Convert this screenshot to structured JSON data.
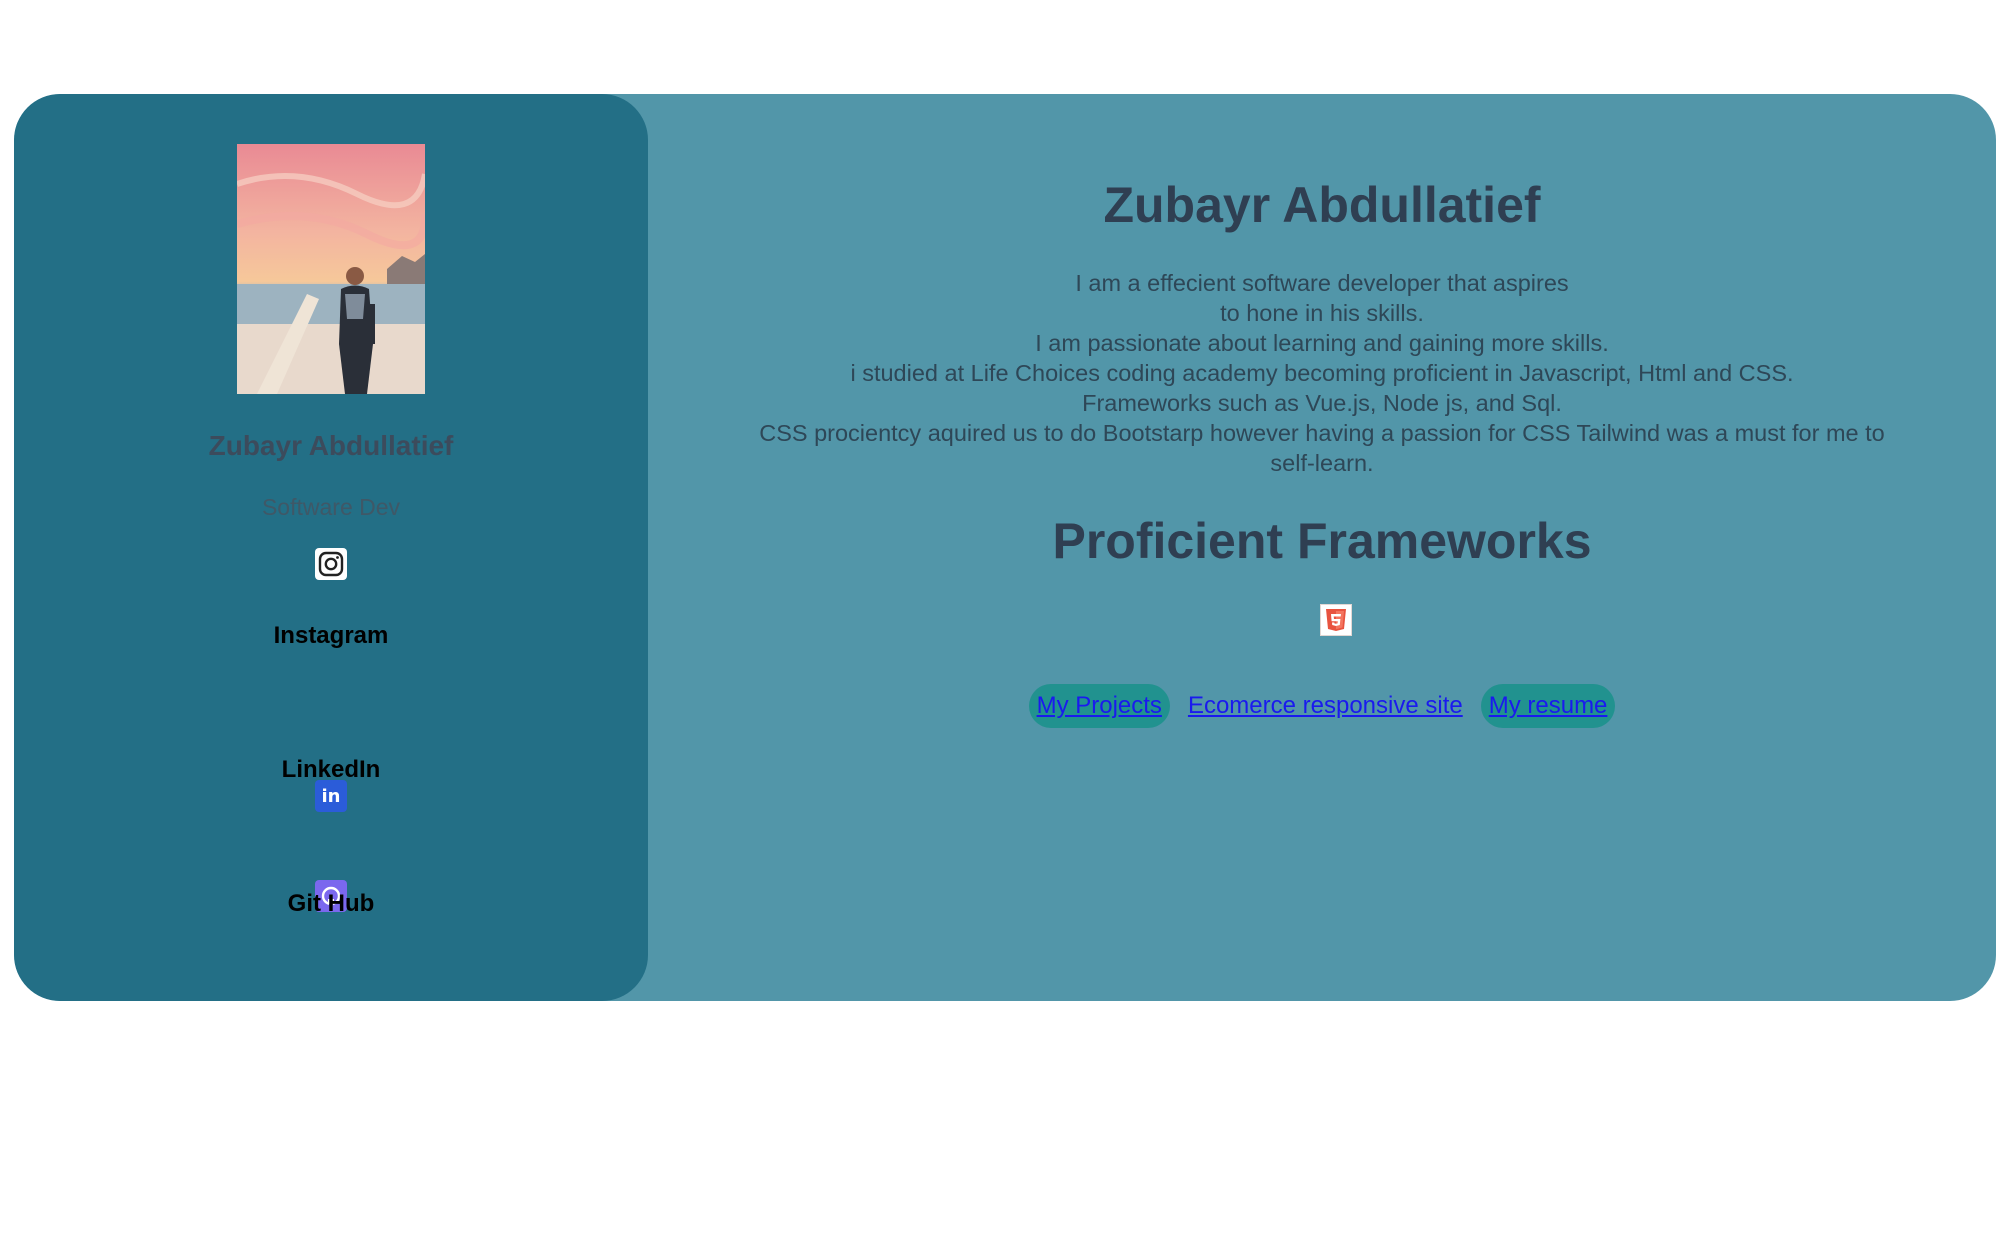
{
  "sidebar": {
    "name": "Zubayr Abdullatief",
    "role": "Software Dev",
    "socials": [
      {
        "label": "Instagram",
        "icon": "instagram-icon"
      },
      {
        "label": "LinkedIn",
        "icon": "linkedin-icon"
      },
      {
        "label": "Git Hub",
        "icon": "github-icon"
      }
    ]
  },
  "main": {
    "title": "Zubayr Abdullatief",
    "bio": [
      "I am a effecient software developer that aspires",
      "to hone in his skills.",
      "I am passionate about learning and gaining more skills.",
      "i studied at Life Choices coding academy becoming proficient in Javascript, Html and CSS.",
      "Frameworks such as Vue.js, Node js, and Sql.",
      "CSS procientcy aquired us to do Bootstarp however having a passion for CSS Tailwind was a must for me to",
      "self-learn."
    ],
    "frameworks_title": "Proficient Frameworks",
    "framework_icon": "html5-icon",
    "links": [
      {
        "label": "My Projects"
      },
      {
        "label": "Ecomerce responsive site"
      },
      {
        "label": "My resume"
      }
    ]
  },
  "colors": {
    "card_bg": "#5296a9",
    "sidebar_bg": "#236f86",
    "heading": "#2f3f52",
    "link": "#1a1aee",
    "pill": "#21928f"
  }
}
